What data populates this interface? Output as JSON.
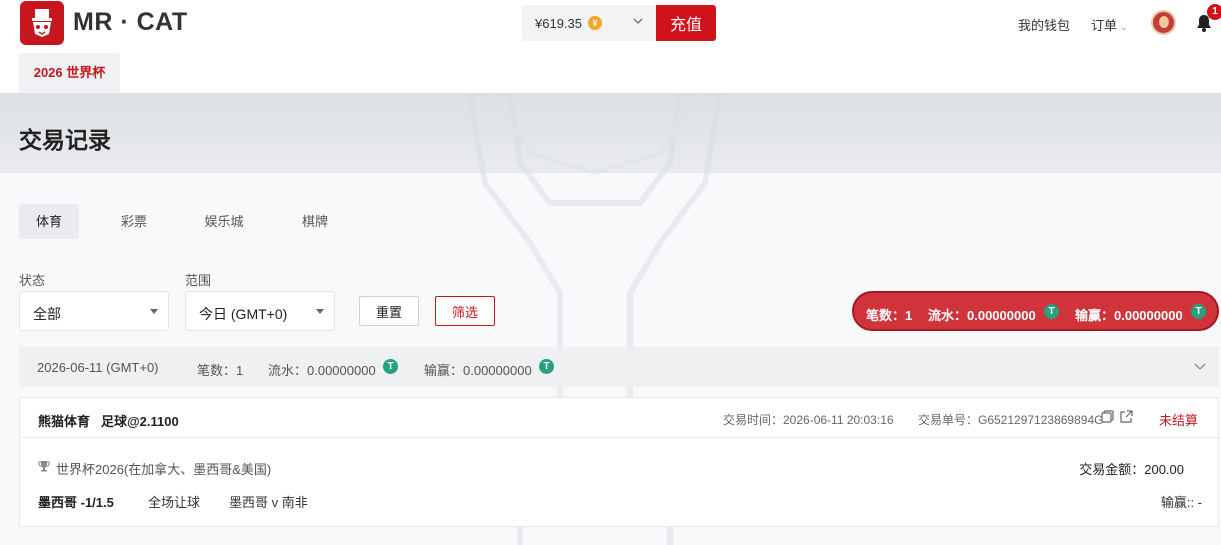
{
  "header": {
    "brand": "MR · CAT",
    "balance": "¥619.35",
    "coin_symbol": "¥",
    "recharge_label": "充值",
    "wallet_label": "我的钱包",
    "orders_label": "订单",
    "notification_count": "1",
    "worldcup_tab": "2026 世界杯"
  },
  "page": {
    "title": "交易记录"
  },
  "tabs": [
    {
      "label": "体育",
      "active": true
    },
    {
      "label": "彩票",
      "active": false
    },
    {
      "label": "娱乐城",
      "active": false
    },
    {
      "label": "棋牌",
      "active": false
    }
  ],
  "filters": {
    "status_label": "状态",
    "status_value": "全部",
    "range_label": "范围",
    "range_value": "今日 (GMT+0)",
    "reset_label": "重置",
    "filter_label": "筛选"
  },
  "summary": {
    "count": "笔数：1",
    "turnover": "流水：0.00000000",
    "winloss": "输赢：0.00000000"
  },
  "day_group": {
    "date": "2026-06-11 (GMT+0)",
    "count": "笔数：1",
    "turnover": "流水：0.00000000",
    "winloss": "输赢：0.00000000"
  },
  "transaction": {
    "provider": "熊猫体育",
    "sport_odds": "足球@2.1100",
    "time_label": "交易时间：2026-06-11 20:03:16",
    "order_label": "交易单号：G6521297123869894G",
    "status": "未结算",
    "league": "世界杯2026(在加拿大、墨西哥&美国)",
    "amount": "交易金额：200.00",
    "selection": "墨西哥 -1/1.5",
    "market": "全场让球",
    "match": "墨西哥 v 南非",
    "winloss": "输赢:: -"
  },
  "colors": {
    "brand_red": "#c8161d",
    "tether_green": "#26a17b",
    "coin_gold": "#f5a623"
  }
}
